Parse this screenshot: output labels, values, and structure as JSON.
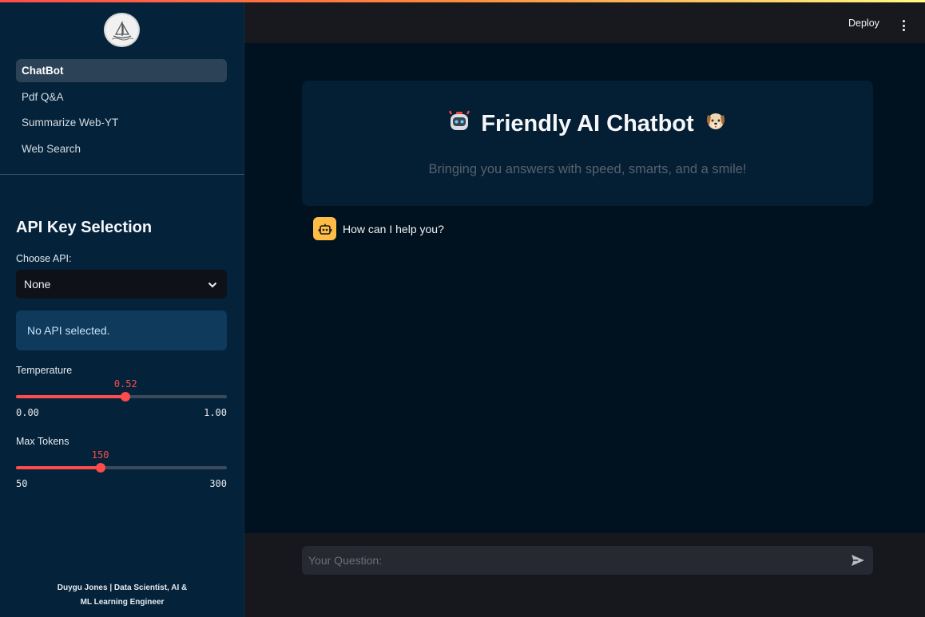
{
  "sidebar": {
    "nav": [
      {
        "label": "ChatBot",
        "active": true
      },
      {
        "label": "Pdf Q&A",
        "active": false
      },
      {
        "label": "Summarize Web-YT",
        "active": false
      },
      {
        "label": "Web Search",
        "active": false
      }
    ],
    "api_title": "API Key Selection",
    "choose_api_label": "Choose API:",
    "choose_api_value": "None",
    "info_message": "No API selected.",
    "temperature": {
      "label": "Temperature",
      "value": "0.52",
      "min": "0.00",
      "max": "1.00"
    },
    "max_tokens": {
      "label": "Max Tokens",
      "value": "150",
      "min": "50",
      "max": "300"
    },
    "footer_line1": "Duygu Jones | Data Scientist, AI &",
    "footer_line2": "ML Learning Engineer"
  },
  "header": {
    "deploy_label": "Deploy"
  },
  "main": {
    "hero_title": "Friendly AI Chatbot",
    "hero_subtitle": "Bringing you answers with speed, smarts, and a smile!",
    "messages": [
      {
        "role": "assistant",
        "text": "How can I help you?"
      }
    ]
  },
  "chat_input": {
    "placeholder": "Your Question:"
  },
  "colors": {
    "accent": "#ff4b4b",
    "sidebar_bg": "#04233a",
    "avatar_bg": "#ffbd45",
    "info_bg": "#0f3a5c"
  },
  "icons": {
    "logo": "sailboat-logo-icon",
    "title_left": "robot-face-icon",
    "title_right": "dog-face-icon",
    "avatar": "bot-icon",
    "send": "send-arrow-icon"
  }
}
